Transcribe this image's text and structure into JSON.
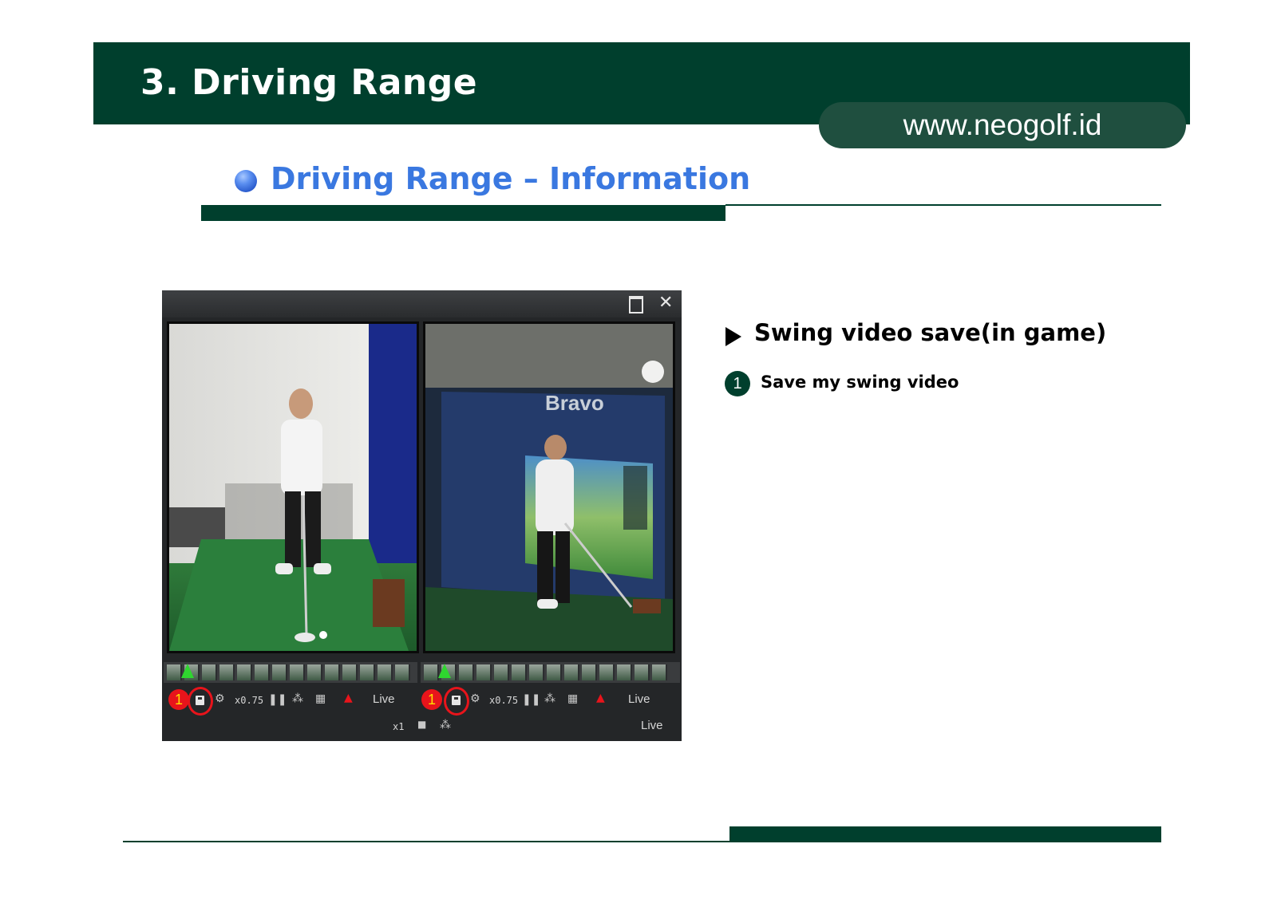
{
  "slide": {
    "title": "3. Driving Range",
    "url": "www.neogolf.id",
    "section_title": "Driving Range – Information"
  },
  "app_window": {
    "left_player": {
      "marker": "1",
      "speed": "x0.75",
      "live_label": "Live"
    },
    "right_player": {
      "marker": "1",
      "speed": "x0.75",
      "live_label": "Live"
    },
    "bottom_bar": {
      "speed": "x1",
      "live_label": "Live"
    },
    "wall_brand": "Bravo"
  },
  "info": {
    "heading": "Swing video save(in game)",
    "steps": [
      {
        "number": "1",
        "text": "Save my swing video"
      }
    ]
  },
  "colors": {
    "brand_green": "#003f2d",
    "accent_blue": "#3a78e0",
    "marker_red": "#e8141b"
  }
}
